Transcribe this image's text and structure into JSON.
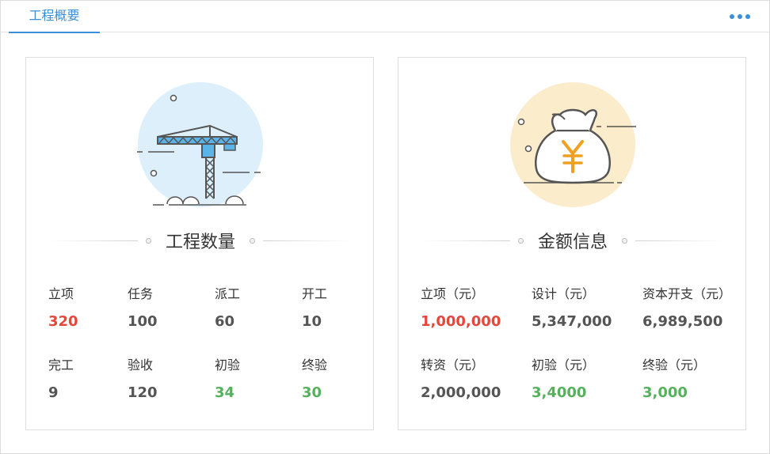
{
  "header": {
    "tab_label": "工程概要",
    "more_icon": "more-dots-icon",
    "accent_color": "#3a8fd6"
  },
  "project_count": {
    "title": "工程数量",
    "illustration": "tower-crane-icon",
    "stats": [
      {
        "label": "立项",
        "value": "320",
        "color": "#e5473a"
      },
      {
        "label": "任务",
        "value": "100",
        "color": "#555555"
      },
      {
        "label": "派工",
        "value": "60",
        "color": "#555555"
      },
      {
        "label": "开工",
        "value": "10",
        "color": "#555555"
      },
      {
        "label": "完工",
        "value": "9",
        "color": "#555555"
      },
      {
        "label": "验收",
        "value": "120",
        "color": "#555555"
      },
      {
        "label": "初验",
        "value": "34",
        "color": "#56b15c"
      },
      {
        "label": "终验",
        "value": "30",
        "color": "#56b15c"
      }
    ]
  },
  "amount_info": {
    "title": "金额信息",
    "illustration": "money-bag-yen-icon",
    "stats": [
      {
        "label": "立项（元）",
        "value": "1,000,000",
        "color": "#e5473a"
      },
      {
        "label": "设计（元）",
        "value": "5,347,000",
        "color": "#555555"
      },
      {
        "label": "资本开支（元）",
        "value": "6,989,500",
        "color": "#555555"
      },
      {
        "label": "转资（元）",
        "value": "2,000,000",
        "color": "#555555"
      },
      {
        "label": "初验（元）",
        "value": "3,4000",
        "color": "#56b15c"
      },
      {
        "label": "终验（元）",
        "value": "3,000",
        "color": "#56b15c"
      }
    ]
  }
}
